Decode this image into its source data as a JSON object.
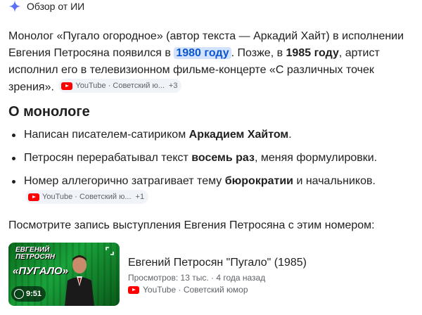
{
  "header": {
    "title": "Обзор от ИИ",
    "icon": "sparkle-icon"
  },
  "intro": {
    "p1": "Монолог «Пугало огородное» (автор текста — Аркадий Хайт) в исполнении Евгения Петросяна появился в ",
    "year1": "1980 году",
    "p2": ". Позже, в ",
    "year2": "1985 году",
    "p3": ", артист исполнил его в телевизионном фильме-концерте «С различных точек зрения».",
    "chip": {
      "source": "YouTube · Советский ю...",
      "more": "+3"
    }
  },
  "section": {
    "title": "О монологе"
  },
  "bullets": [
    {
      "pre": "Написан писателем-сатириком ",
      "bold": "Аркадием Хайтом",
      "post": "."
    },
    {
      "pre": "Петросян перерабатывал текст ",
      "bold": "восемь раз",
      "post": ", меняя формулировки."
    },
    {
      "pre": "Номер аллегорично затрагивает тему ",
      "bold": "бюрократии",
      "post": " и начальников.",
      "chip": {
        "source": "YouTube · Советский ю...",
        "more": "+1"
      }
    }
  ],
  "watch_text": "Посмотрите запись выступления Евгения Петросяна с этим номером:",
  "video": {
    "thumb_line1": "ЕВГЕНИЙ",
    "thumb_line2": "ПЕТРОСЯН",
    "thumb_title": "«ПУГАЛО»",
    "duration": "9:51",
    "title": "Евгений Петросян \"Пугало\" (1985)",
    "meta": "Просмотров: 13 тыс. · 4 года назад",
    "source": "YouTube · Советский юмор"
  },
  "colors": {
    "highlight_bg": "#d3e3fd",
    "highlight_text": "#0b57d0",
    "youtube_red": "#ff0000",
    "chip_bg": "#f0f4f9"
  }
}
